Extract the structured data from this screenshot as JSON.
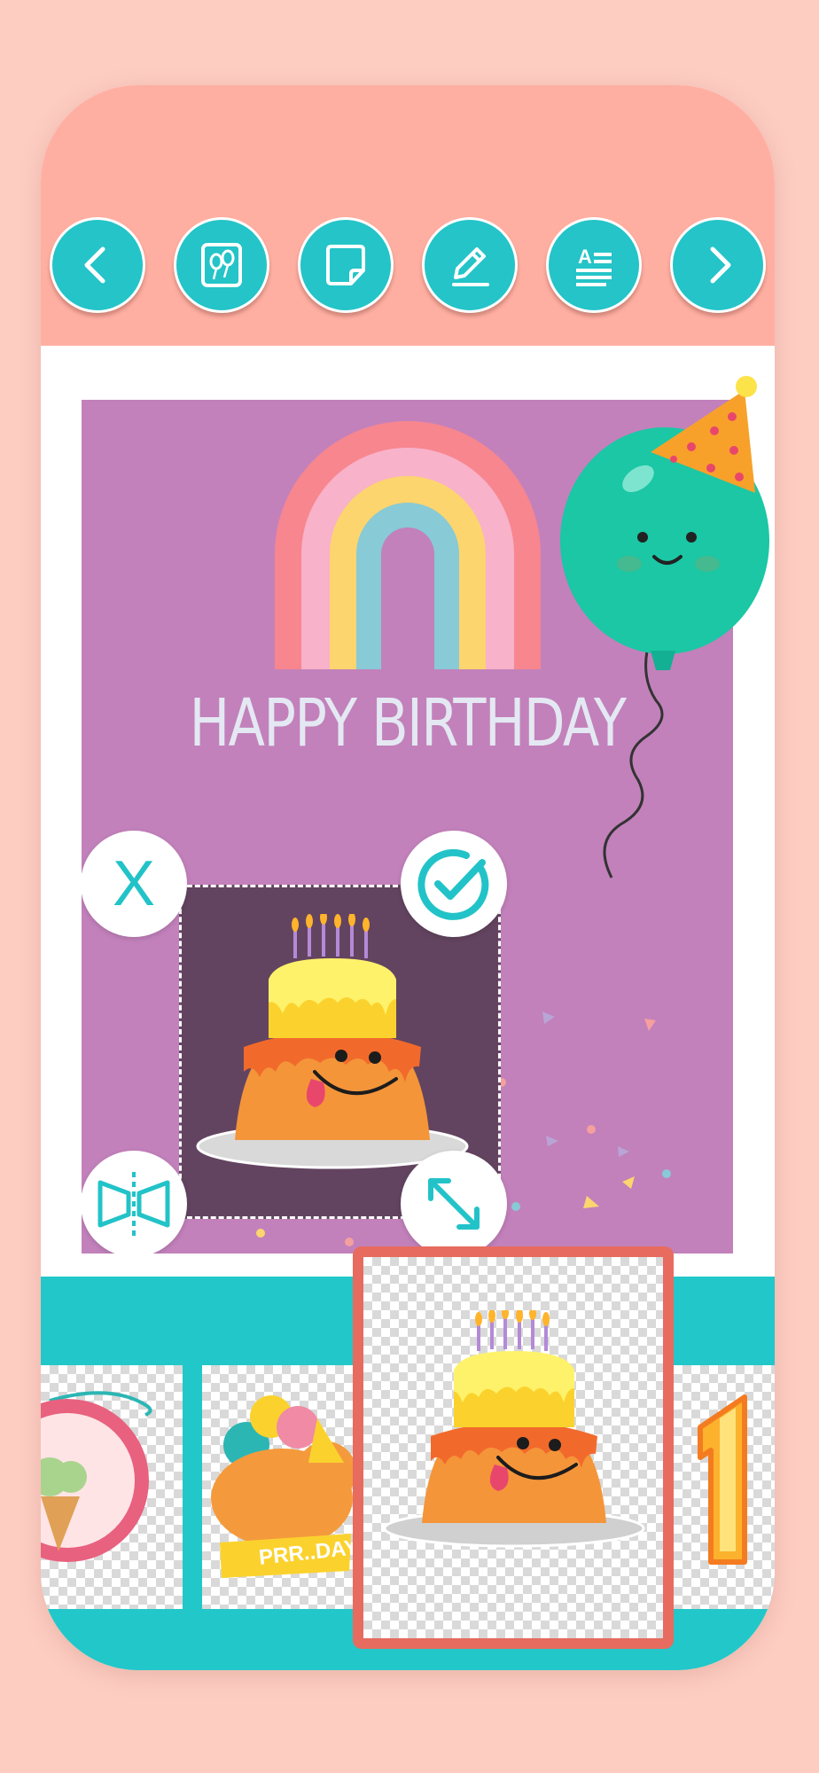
{
  "toolbar": {
    "buttons": [
      {
        "name": "back-button",
        "icon": "chevron-left-icon"
      },
      {
        "name": "background-button",
        "icon": "balloon-frame-icon"
      },
      {
        "name": "sticker-button",
        "icon": "sticky-note-icon"
      },
      {
        "name": "draw-button",
        "icon": "pencil-icon"
      },
      {
        "name": "text-button",
        "icon": "text-format-icon"
      },
      {
        "name": "next-button",
        "icon": "chevron-right-icon"
      }
    ],
    "color": "#ffafa2",
    "button_color": "#24c4c8"
  },
  "card": {
    "title": "HAPPY BIRTHDAY",
    "background": "#c281bb"
  },
  "selection": {
    "delete_label": "X",
    "confirm_icon": "check-circle-icon",
    "flip_icon": "flip-horizontal-icon",
    "resize_icon": "resize-arrows-icon",
    "sticker": "cake-sticker"
  },
  "sticker_strip": {
    "color": "#22c7c9",
    "selected_border": "#e76b5f",
    "items": [
      {
        "name": "ice-cream-badge-sticker"
      },
      {
        "name": "cat-party-sticker",
        "text": "PRR..DAY"
      },
      {
        "name": "cake-sticker",
        "selected": true
      },
      {
        "name": "number-one-sticker"
      }
    ]
  }
}
